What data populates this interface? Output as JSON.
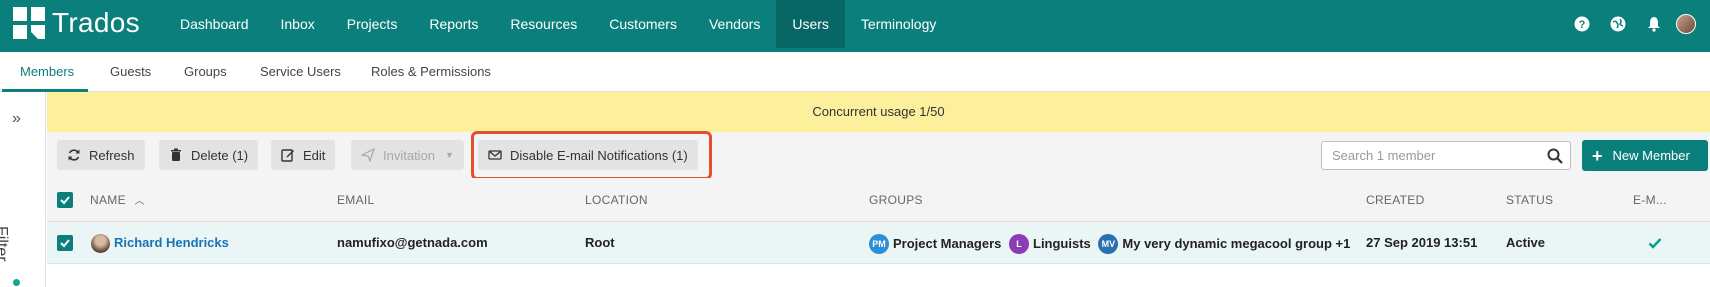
{
  "app": {
    "name": "Trados",
    "nav": [
      "Dashboard",
      "Inbox",
      "Projects",
      "Reports",
      "Resources",
      "Customers",
      "Vendors",
      "Users",
      "Terminology"
    ],
    "active_nav": "Users",
    "icons": [
      "help-icon",
      "globe-icon",
      "bell-icon",
      "avatar"
    ]
  },
  "subtabs": [
    "Members",
    "Guests",
    "Groups",
    "Service Users",
    "Roles & Permissions"
  ],
  "active_subtab": "Members",
  "filter": {
    "label": "Filter"
  },
  "banner": {
    "text": "Concurrent usage 1/50"
  },
  "toolbar": {
    "refresh": "Refresh",
    "delete": "Delete (1)",
    "edit": "Edit",
    "invitation": "Invitation",
    "disable_notifications": "Disable E-mail Notifications (1)",
    "search_placeholder": "Search 1 member",
    "new_member": "New Member"
  },
  "table": {
    "columns": [
      "NAME",
      "EMAIL",
      "LOCATION",
      "GROUPS",
      "CREATED",
      "STATUS",
      "E-M..."
    ],
    "rows": [
      {
        "name": "Richard Hendricks",
        "email": "namufixo@getnada.com",
        "location": "Root",
        "groups": [
          {
            "badge": "PM",
            "name": "Project Managers",
            "color": "#2f8fd6"
          },
          {
            "badge": "L",
            "name": "Linguists",
            "color": "#8b3db5"
          },
          {
            "badge": "MV",
            "name": "My very dynamic megacool group +1",
            "color": "#2a6fb0"
          }
        ],
        "created": "27 Sep 2019 13:51",
        "status": "Active",
        "email_notifications": true
      }
    ]
  },
  "colors": {
    "brand": "#0b7f7c",
    "banner": "#fdf09c",
    "highlight": "#e4502b",
    "selected_row": "#eaf6f5"
  }
}
